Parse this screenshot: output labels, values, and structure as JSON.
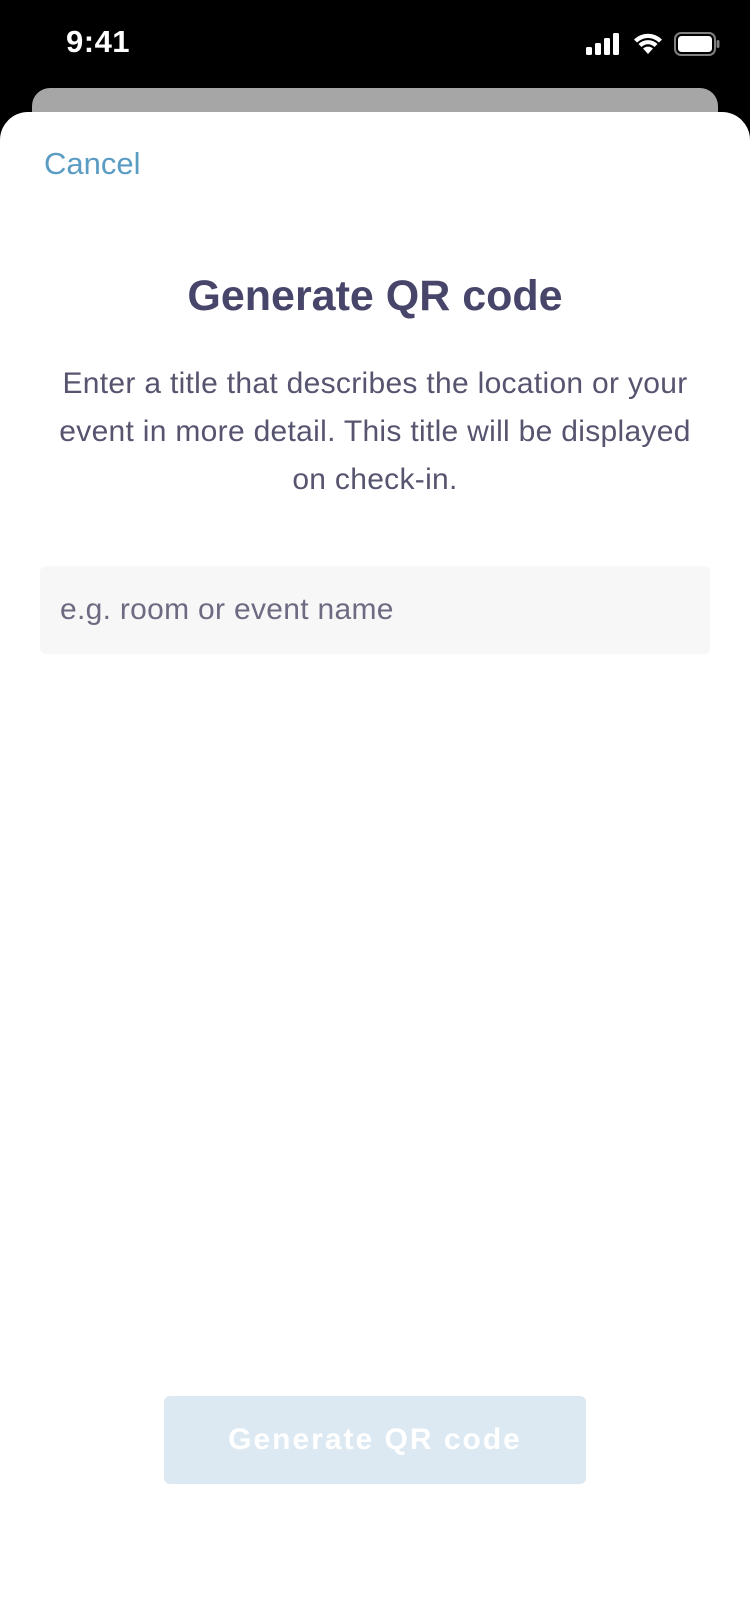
{
  "status_bar": {
    "time": "9:41",
    "icons": [
      "cellular-signal-icon",
      "wifi-icon",
      "battery-icon"
    ]
  },
  "sheet": {
    "cancel_label": "Cancel",
    "title": "Generate QR code",
    "description": "Enter a title that describes the location or your event in more detail. This title will be displayed on check-in.",
    "input": {
      "value": "",
      "placeholder": "e.g. room or event name"
    },
    "generate_label": "Generate QR code",
    "generate_enabled": false
  },
  "colors": {
    "accent": "#5b9cc4",
    "title": "#47456a",
    "button_disabled": "#dce9f2",
    "input_background": "#f7f7f7"
  }
}
